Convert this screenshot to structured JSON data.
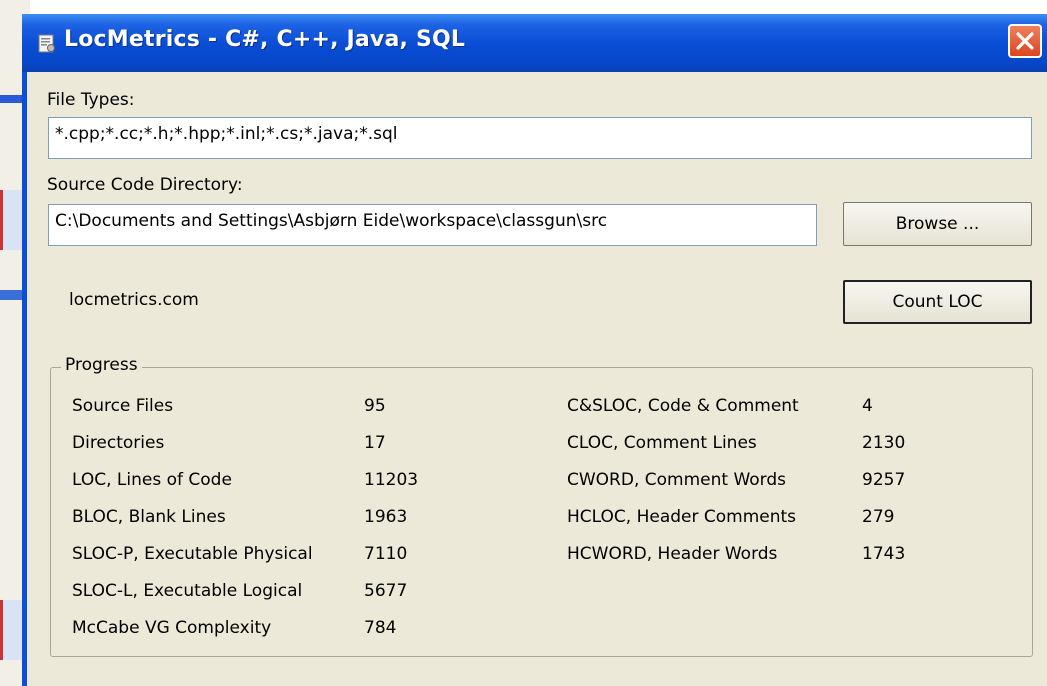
{
  "window": {
    "title": "LocMetrics - C#, C++, Java, SQL"
  },
  "file_types": {
    "label": "File Types:",
    "value": "*.cpp;*.cc;*.h;*.hpp;*.inl;*.cs;*.java;*.sql"
  },
  "source_dir": {
    "label": "Source Code Directory:",
    "value": "C:\\Documents and Settings\\Asbjørn Eide\\workspace\\classgun\\src",
    "browse_label": "Browse ..."
  },
  "site": "locmetrics.com",
  "count_label": "Count LOC",
  "progress": {
    "title": "Progress",
    "left": [
      {
        "label": "Source Files",
        "value": "95"
      },
      {
        "label": "Directories",
        "value": "17"
      },
      {
        "label": "LOC, Lines of Code",
        "value": "11203"
      },
      {
        "label": "BLOC, Blank Lines",
        "value": "1963"
      },
      {
        "label": "SLOC-P, Executable Physical",
        "value": "7110"
      },
      {
        "label": "SLOC-L, Executable Logical",
        "value": "5677"
      },
      {
        "label": "McCabe VG Complexity",
        "value": "784"
      }
    ],
    "right": [
      {
        "label": "C&SLOC, Code & Comment",
        "value": "4"
      },
      {
        "label": "CLOC, Comment Lines",
        "value": "2130"
      },
      {
        "label": "CWORD, Comment Words",
        "value": "9257"
      },
      {
        "label": "HCLOC, Header Comments",
        "value": "279"
      },
      {
        "label": "HCWORD, Header Words",
        "value": "1743"
      }
    ]
  },
  "colors": {
    "titlebar": "#0a4ed6",
    "window_bg": "#ece9d8",
    "close": "#d9461f"
  }
}
